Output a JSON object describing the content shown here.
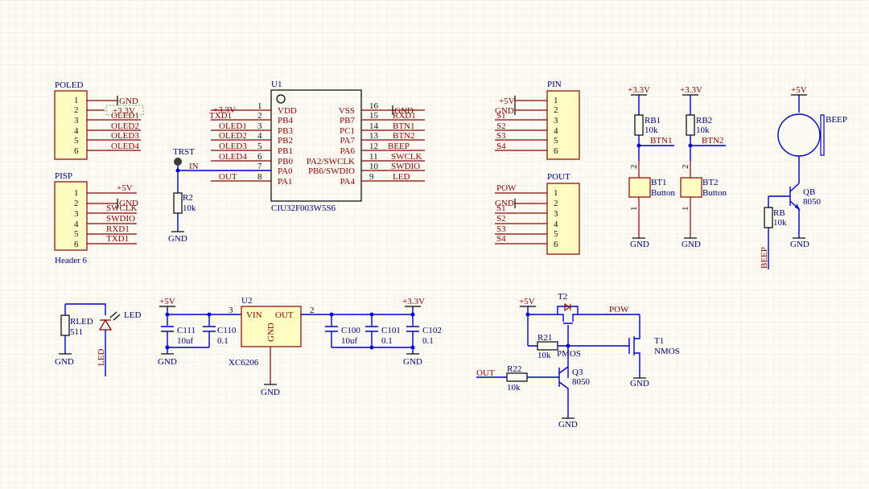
{
  "poled": {
    "title": "POLED",
    "pins": [
      "1",
      "2",
      "3",
      "4",
      "5",
      "6"
    ],
    "nets": [
      "GND",
      "+3.3V",
      "OLED1",
      "OLED2",
      "OLED3",
      "OLED4"
    ]
  },
  "pisp": {
    "title": "PISP",
    "pins": [
      "1",
      "2",
      "3",
      "4",
      "5",
      "6"
    ],
    "nets": [
      "+5V",
      "GND",
      "SWCLK",
      "SWDIO",
      "RXD1",
      "TXD1"
    ],
    "comment": "Header 6"
  },
  "u1": {
    "designator": "U1",
    "part": "CIU32F003W5S6",
    "left_pins": [
      "VDD",
      "PB4",
      "PB3",
      "PB2",
      "PB1",
      "PB0",
      "PA0",
      "PA1"
    ],
    "left_nums": [
      "1",
      "2",
      "3",
      "4",
      "5",
      "6",
      "7",
      "8"
    ],
    "left_nets": [
      "+3.3V",
      "TXD1",
      "OLED1",
      "OLED2",
      "OLED3",
      "OLED4",
      "IN",
      "OUT"
    ],
    "right_pins": [
      "VSS",
      "PB7",
      "PC1",
      "PA7",
      "PA6",
      "PA2/SWCLK",
      "PB6/SWDIO",
      "PA4"
    ],
    "right_nums": [
      "16",
      "15",
      "14",
      "13",
      "12",
      "11",
      "10",
      "9"
    ],
    "right_nets": [
      "GND",
      "RXD1",
      "BTN1",
      "BTN2",
      "BEEP",
      "SWCLK",
      "SWDIO",
      "LED"
    ]
  },
  "trst": {
    "label": "TRST",
    "net": "IN"
  },
  "r2": {
    "designator": "R2",
    "value": "10k",
    "gnd": "GND"
  },
  "pin": {
    "title": "PIN",
    "pins": [
      "1",
      "2",
      "3",
      "4",
      "5",
      "6"
    ],
    "nets": [
      "+5V",
      "GND",
      "S1",
      "S2",
      "S3",
      "S4"
    ]
  },
  "pout": {
    "title": "POUT",
    "pins": [
      "1",
      "2",
      "3",
      "4",
      "5",
      "6"
    ],
    "nets": [
      "POW",
      "GND",
      "S1",
      "S2",
      "S3",
      "S4"
    ]
  },
  "rb1": {
    "designator": "RB1",
    "value": "10k",
    "rail": "+3.3V",
    "net": "BTN1"
  },
  "rb2": {
    "designator": "RB2",
    "value": "10k",
    "rail": "+3.3V",
    "net": "BTN2"
  },
  "bt1": {
    "designator": "BT1",
    "value": "Button",
    "p1": "1",
    "p2": "2",
    "gnd": "GND"
  },
  "bt2": {
    "designator": "BT2",
    "value": "Button",
    "p1": "1",
    "p2": "2",
    "gnd": "GND"
  },
  "beep": {
    "label": "BEEP",
    "rail": "+5V",
    "net": "BEEP"
  },
  "qb": {
    "designator": "QB",
    "value": "8050",
    "gnd": "GND"
  },
  "rb": {
    "designator": "RB",
    "value": "10k"
  },
  "led": {
    "designator": "LED",
    "net": "LED"
  },
  "rled": {
    "designator": "RLED",
    "value": "511",
    "gnd": "GND"
  },
  "u2": {
    "designator": "U2",
    "part": "XC6206",
    "vin": "VIN",
    "out": "OUT",
    "gnd": "GND",
    "pin_in": "3",
    "pin_out": "2"
  },
  "reg": {
    "in_rail": "+5V",
    "out_rail": "+3.3V",
    "gnd1": "GND",
    "gnd2": "GND",
    "gnd3": "GND"
  },
  "caps": [
    {
      "designator": "C111",
      "value": "10uf"
    },
    {
      "designator": "C110",
      "value": "0.1"
    },
    {
      "designator": "C100",
      "value": "10uf"
    },
    {
      "designator": "C101",
      "value": "0.1"
    },
    {
      "designator": "C102",
      "value": "0.1"
    }
  ],
  "sw": {
    "rail": "+5V",
    "t2": "T2",
    "pmos": "PMOS",
    "pow": "POW",
    "t1": "T1",
    "nmos": "NMOS",
    "r21": "R21",
    "r21v": "10k",
    "r22": "R22",
    "r22v": "10k",
    "q3": "Q3",
    "q3v": "8050",
    "out": "OUT",
    "gnd1": "GND",
    "gnd2": "GND"
  }
}
